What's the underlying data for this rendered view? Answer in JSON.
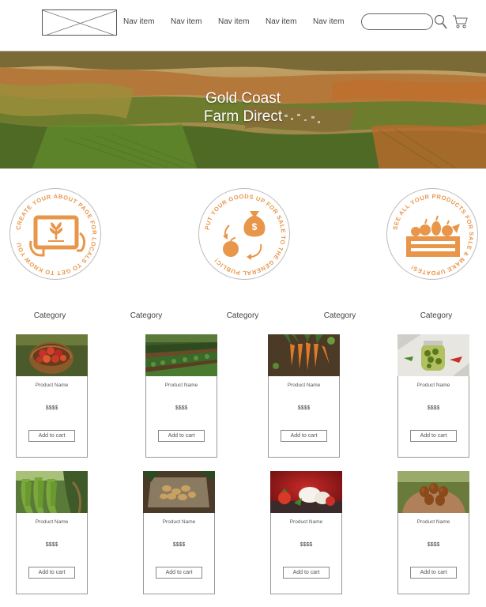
{
  "header": {
    "nav_items": [
      "Nav item",
      "Nav item",
      "Nav item",
      "Nav item",
      "Nav item"
    ]
  },
  "hero": {
    "title_line1": "Gold Coast",
    "title_line2": "Farm Direct"
  },
  "badges": [
    {
      "text": "CREATE YOUR ABOUT PAGE FOR LOCALS TO GET TO KNOW YOU",
      "icon": "tablet-sprout-icon"
    },
    {
      "text": "PUT YOUR GOODS UP FOR SALE TO THE GENERAL PUBLIC!",
      "icon": "money-exchange-icon"
    },
    {
      "text": "SEE ALL YOUR PRODUCTS FOR SALE & MAKE UPDATES!",
      "icon": "produce-crate-icon"
    }
  ],
  "categories": [
    "Category",
    "Category",
    "Category",
    "Category",
    "Category"
  ],
  "products": [
    {
      "name": "Product Name",
      "price": "$$$$",
      "button": "Add to cart",
      "image": "apple-basket"
    },
    {
      "name": "Product Name",
      "price": "$$$$",
      "button": "Add to cart",
      "image": "crop-rows"
    },
    {
      "name": "Product Name",
      "price": "$$$$",
      "button": "Add to cart",
      "image": "carrots"
    },
    {
      "name": "Product Name",
      "price": "$$$$",
      "button": "Add to cart",
      "image": "olive-jar"
    },
    {
      "name": "Product Name",
      "price": "$$$$",
      "button": "Add to cart",
      "image": "bananas"
    },
    {
      "name": "Product Name",
      "price": "$$$$",
      "button": "Add to cart",
      "image": "potatoes"
    },
    {
      "name": "Product Name",
      "price": "$$$$",
      "button": "Add to cart",
      "image": "mozzarella-tomato"
    },
    {
      "name": "Product Name",
      "price": "$$$$",
      "button": "Add to cart",
      "image": "fruit-hands"
    }
  ],
  "colors": {
    "accent": "#E8964A",
    "border": "#999999",
    "hero_text": "#FFFFFF"
  }
}
